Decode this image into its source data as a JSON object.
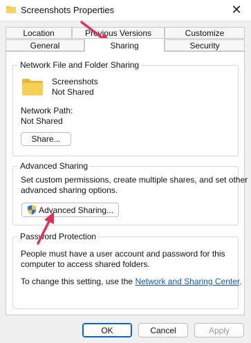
{
  "window": {
    "title": "Screenshots Properties",
    "close_glyph": "✕"
  },
  "tabs": {
    "row1": [
      "Location",
      "Previous Versions",
      "Customize"
    ],
    "row2": [
      "General",
      "Sharing",
      "Security"
    ],
    "active": "Sharing"
  },
  "network_sharing": {
    "heading": "Network File and Folder Sharing",
    "folder_name": "Screenshots",
    "folder_status": "Not Shared",
    "path_label": "Network Path:",
    "path_value": "Not Shared",
    "share_button": "Share..."
  },
  "advanced_sharing": {
    "heading": "Advanced Sharing",
    "description_line1": "Set custom permissions, create multiple shares, and set other",
    "description_line2": "advanced sharing options.",
    "button": "Advanced Sharing..."
  },
  "password_protection": {
    "heading": "Password Protection",
    "line1": "People must have a user account and password for this",
    "line2": "computer to access shared folders.",
    "change_prefix": "To change this setting, use the ",
    "change_link": "Network and Sharing Center",
    "change_suffix": "."
  },
  "footer": {
    "ok": "OK",
    "cancel": "Cancel",
    "apply": "Apply"
  },
  "colors": {
    "accent": "#0a64c8",
    "arrow": "#e0305a",
    "folder": "#f3c94c"
  }
}
